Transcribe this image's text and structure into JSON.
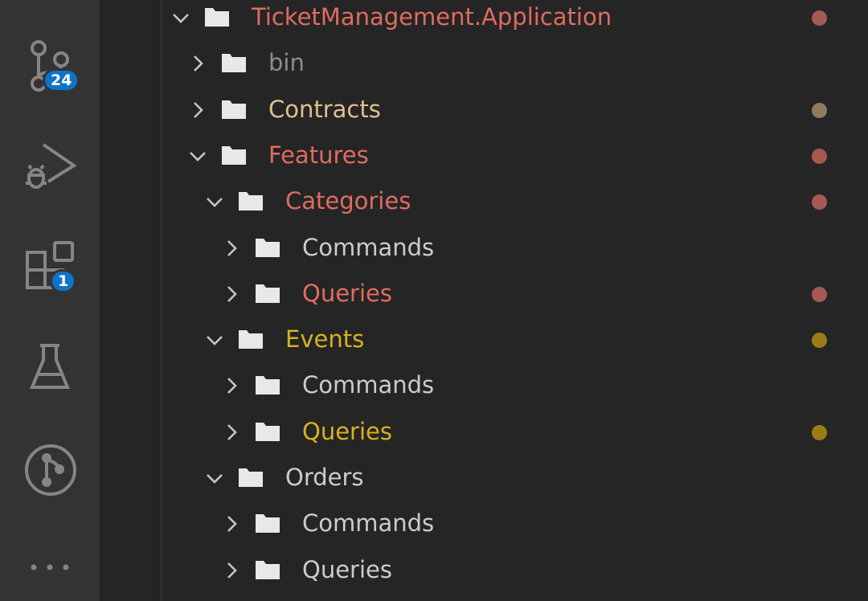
{
  "activity_bar": {
    "source_control_badge": "24",
    "extensions_badge": "1",
    "more_label": "..."
  },
  "colors": {
    "modified_red": "#e06c5f",
    "modified_dot_red": "#a45a52",
    "untracked_gold": "#d7b21f",
    "untracked_dot_gold": "#9b7d14",
    "contracts_text": "#e2c08d",
    "contracts_dot": "#8f7c5e",
    "default_text": "#cccccc",
    "ignored_text": "#8c8c8c"
  },
  "explorer": {
    "items": [
      {
        "label": "TicketManagement.Application",
        "expanded": true,
        "status": "modified"
      },
      {
        "label": "bin",
        "expanded": false,
        "status": "ignored"
      },
      {
        "label": "Contracts",
        "expanded": false,
        "status": "contracts"
      },
      {
        "label": "Features",
        "expanded": true,
        "status": "modified"
      },
      {
        "label": "Categories",
        "expanded": true,
        "status": "modified"
      },
      {
        "label": "Commands",
        "expanded": false,
        "status": "none"
      },
      {
        "label": "Queries",
        "expanded": false,
        "status": "modified"
      },
      {
        "label": "Events",
        "expanded": true,
        "status": "untracked"
      },
      {
        "label": "Commands",
        "expanded": false,
        "status": "none"
      },
      {
        "label": "Queries",
        "expanded": false,
        "status": "untracked"
      },
      {
        "label": "Orders",
        "expanded": true,
        "status": "none"
      },
      {
        "label": "Commands",
        "expanded": false,
        "status": "none"
      },
      {
        "label": "Queries",
        "expanded": false,
        "status": "none"
      }
    ]
  }
}
